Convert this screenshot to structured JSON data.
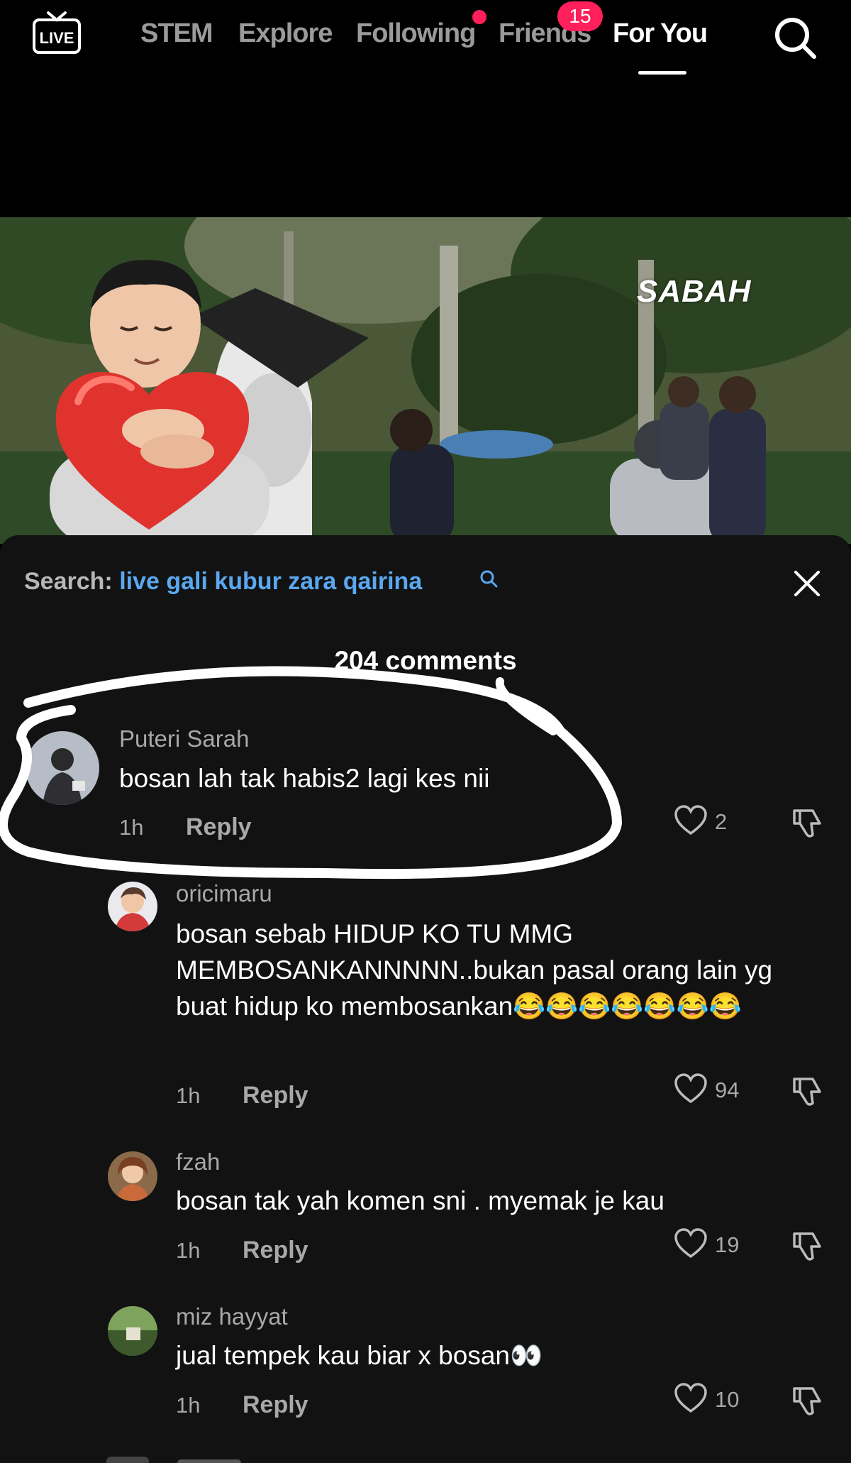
{
  "nav": {
    "live_label": "LIVE",
    "tabs": [
      "STEM",
      "Explore",
      "Following",
      "Friends",
      "For You"
    ],
    "active_tab": "For You",
    "friends_badge": "15",
    "accent_color": "#ff1f5a"
  },
  "video": {
    "watermark": "SABAH"
  },
  "comments_panel": {
    "search_label": "Search:",
    "search_query": "live gali kubur zara qairina",
    "count_label": "204 comments"
  },
  "comments": [
    {
      "user": "Puteri Sarah",
      "text": "bosan lah tak habis2 lagi kes nii",
      "time": "1h",
      "reply_label": "Reply",
      "likes": "2"
    },
    {
      "user": "oricimaru",
      "text": "bosan sebab HIDUP KO TU MMG MEMBOSANKANNNNN..bukan pasal orang lain yg buat hidup ko membosankan😂😂😂😂😂😂😂",
      "time": "1h",
      "reply_label": "Reply",
      "likes": "94"
    },
    {
      "user": "fzah",
      "text": "bosan tak yah komen sni . myemak je kau",
      "time": "1h",
      "reply_label": "Reply",
      "likes": "19"
    },
    {
      "user": "miz hayyat",
      "text": "jual tempek kau biar x bosan👀",
      "time": "1h",
      "reply_label": "Reply",
      "likes": "10"
    }
  ]
}
